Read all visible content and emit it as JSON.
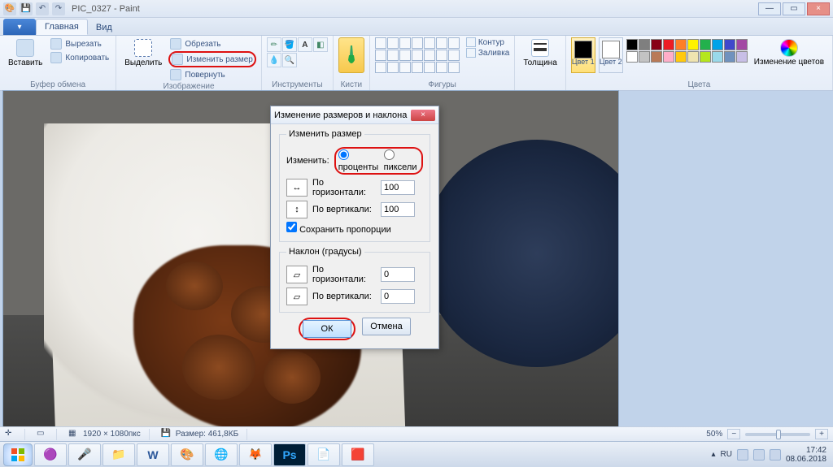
{
  "window": {
    "doc_title": "PIC_0327 - Paint",
    "min": "—",
    "max": "▭",
    "close": "×"
  },
  "ribbon": {
    "file_tab": "",
    "tabs": {
      "home": "Главная",
      "view": "Вид"
    },
    "groups": {
      "clipboard": {
        "paste": "Вставить",
        "cut": "Вырезать",
        "copy": "Копировать",
        "label": "Буфер обмена"
      },
      "image": {
        "select": "Выделить",
        "crop": "Обрезать",
        "resize": "Изменить размер",
        "rotate": "Повернуть",
        "label": "Изображение"
      },
      "tools": {
        "label": "Инструменты"
      },
      "brushes": {
        "label": "Кисти"
      },
      "shapes": {
        "outline": "Контур",
        "fill": "Заливка",
        "label": "Фигуры"
      },
      "size": {
        "label": "Толщина"
      },
      "colors": {
        "c1": "Цвет 1",
        "c2": "Цвет 2",
        "edit": "Изменение цветов",
        "label": "Цвета"
      }
    }
  },
  "dialog": {
    "title": "Изменение размеров и наклона",
    "resize_legend": "Изменить размер",
    "by_label": "Изменить:",
    "percent": "проценты",
    "pixels": "пиксели",
    "horiz": "По горизонтали:",
    "vert": "По вертикали:",
    "h_val": "100",
    "v_val": "100",
    "keep_aspect": "Сохранить пропорции",
    "skew_legend": "Наклон (градусы)",
    "sk_h": "По горизонтали:",
    "sk_v": "По вертикали:",
    "sk_h_val": "0",
    "sk_v_val": "0",
    "ok": "ОК",
    "cancel": "Отмена"
  },
  "status": {
    "dims": "1920 × 1080пкс",
    "size_label": "Размер: 461,8КБ",
    "zoom": "50%",
    "zoom_minus": "−",
    "zoom_plus": "+"
  },
  "taskbar": {
    "lang": "RU",
    "time": "17:42",
    "date": "08.06.2018"
  },
  "palette_colors": [
    "#000",
    "#7f7f7f",
    "#880015",
    "#ed1c24",
    "#ff7f27",
    "#fff200",
    "#22b14c",
    "#00a2e8",
    "#3f48cc",
    "#a349a4",
    "#fff",
    "#c3c3c3",
    "#b97a57",
    "#ffaec9",
    "#ffc90e",
    "#efe4b0",
    "#b5e61d",
    "#99d9ea",
    "#7092be",
    "#c8bfe7"
  ]
}
